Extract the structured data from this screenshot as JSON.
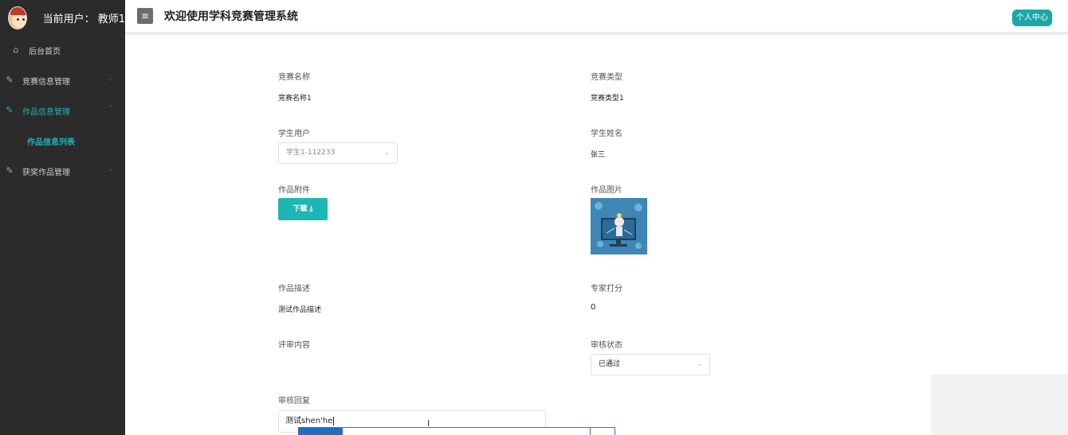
{
  "sidebar": {
    "current_user": "当前用户：   教师1",
    "menu": {
      "home": "后台首页",
      "competition_info": "竞赛信息管理",
      "work_info": "作品信息管理",
      "work_list": "作品信息列表",
      "award_works": "获奖作品管理"
    }
  },
  "header": {
    "title": "欢迎使用学科竞赛管理系统",
    "profile_button": "个人中心"
  },
  "form": {
    "competition_name_label": "竞赛名称",
    "competition_name_value": "竞赛名称1",
    "competition_type_label": "竞赛类型",
    "competition_type_value": "竞赛类型1",
    "student_user_label": "学生用户",
    "student_user_value": "学生1-112233",
    "student_name_label": "学生姓名",
    "student_name_value": "张三",
    "attachment_label": "作品附件",
    "download_button": "下载 ⤓",
    "image_label": "作品图片",
    "description_label": "作品描述",
    "description_value": "测试作品描述",
    "expert_score_label": "专家打分",
    "expert_score_value": "0",
    "review_content_label": "评审内容",
    "review_status_label": "审核状态",
    "review_status_value": "已通过",
    "review_reply_label": "审核回复",
    "review_reply_value": "测试shen'he"
  },
  "colors": {
    "accent": "#1fb5b5",
    "sidebar_bg": "#2b2b2b"
  }
}
